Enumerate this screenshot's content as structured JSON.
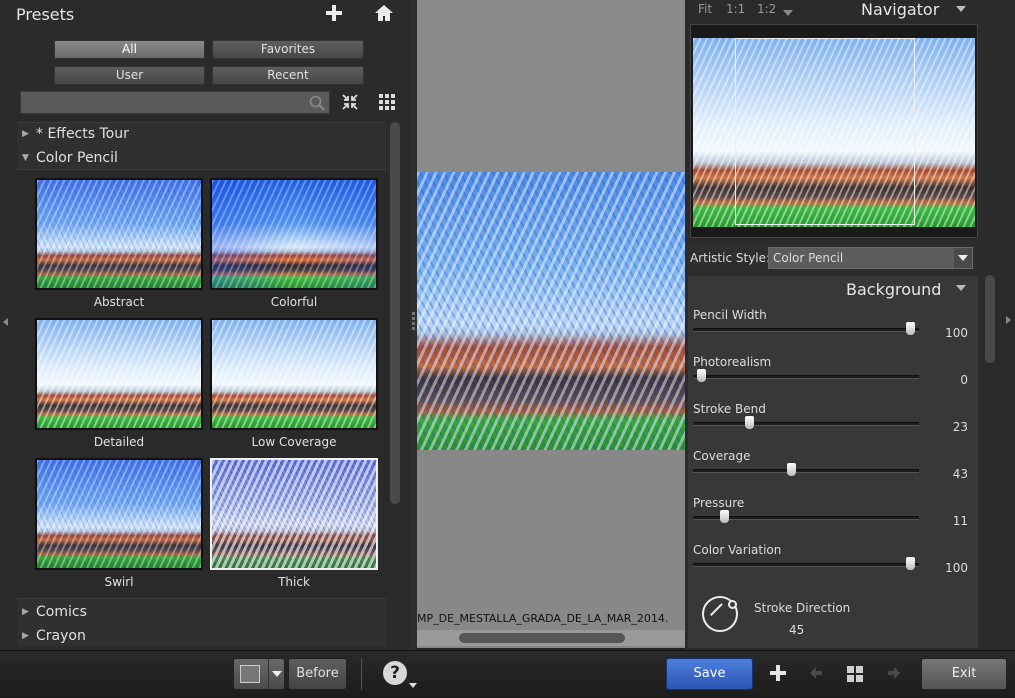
{
  "presets": {
    "title": "Presets",
    "filters": [
      {
        "label": "All",
        "active": true
      },
      {
        "label": "Favorites",
        "active": false
      },
      {
        "label": "User",
        "active": false
      },
      {
        "label": "Recent",
        "active": false
      }
    ],
    "search": {
      "value": "",
      "placeholder": ""
    },
    "tree": [
      {
        "label": "* Effects Tour",
        "expanded": false
      },
      {
        "label": "Color Pencil",
        "expanded": true
      },
      {
        "label": "Comics",
        "expanded": false
      },
      {
        "label": "Crayon",
        "expanded": false
      }
    ],
    "thumbnails": [
      {
        "caption": "Abstract",
        "selected": false
      },
      {
        "caption": "Colorful",
        "selected": false
      },
      {
        "caption": "Detailed",
        "selected": false
      },
      {
        "caption": "Low Coverage",
        "selected": false
      },
      {
        "caption": "Swirl",
        "selected": false
      },
      {
        "caption": "Thick",
        "selected": true
      }
    ]
  },
  "canvas": {
    "filename": "MP_DE_MESTALLA_GRADA_DE_LA_MAR_2014."
  },
  "navigator": {
    "title": "Navigator",
    "zoom_options": [
      "Fit",
      "1:1",
      "1:2"
    ]
  },
  "style": {
    "label": "Artistic Style:",
    "value": "Color Pencil"
  },
  "params": {
    "title": "Background",
    "sliders": [
      {
        "label": "Pencil Width",
        "value": "100",
        "fraction": 1.0
      },
      {
        "label": "Photorealism",
        "value": "0",
        "fraction": 0.0
      },
      {
        "label": "Stroke Bend",
        "value": "23",
        "fraction": 0.23
      },
      {
        "label": "Coverage",
        "value": "43",
        "fraction": 0.43
      },
      {
        "label": "Pressure",
        "value": "11",
        "fraction": 0.11
      },
      {
        "label": "Color Variation",
        "value": "100",
        "fraction": 1.0
      }
    ],
    "stroke_direction": {
      "label": "Stroke Direction",
      "value": "45"
    }
  },
  "bottom": {
    "before_label": "Before",
    "help_label": "?",
    "save_label": "Save",
    "exit_label": "Exit"
  },
  "colors": {
    "save": "#3a66c6",
    "panel": "#2b2b2b",
    "canvas_bg": "#888888"
  }
}
